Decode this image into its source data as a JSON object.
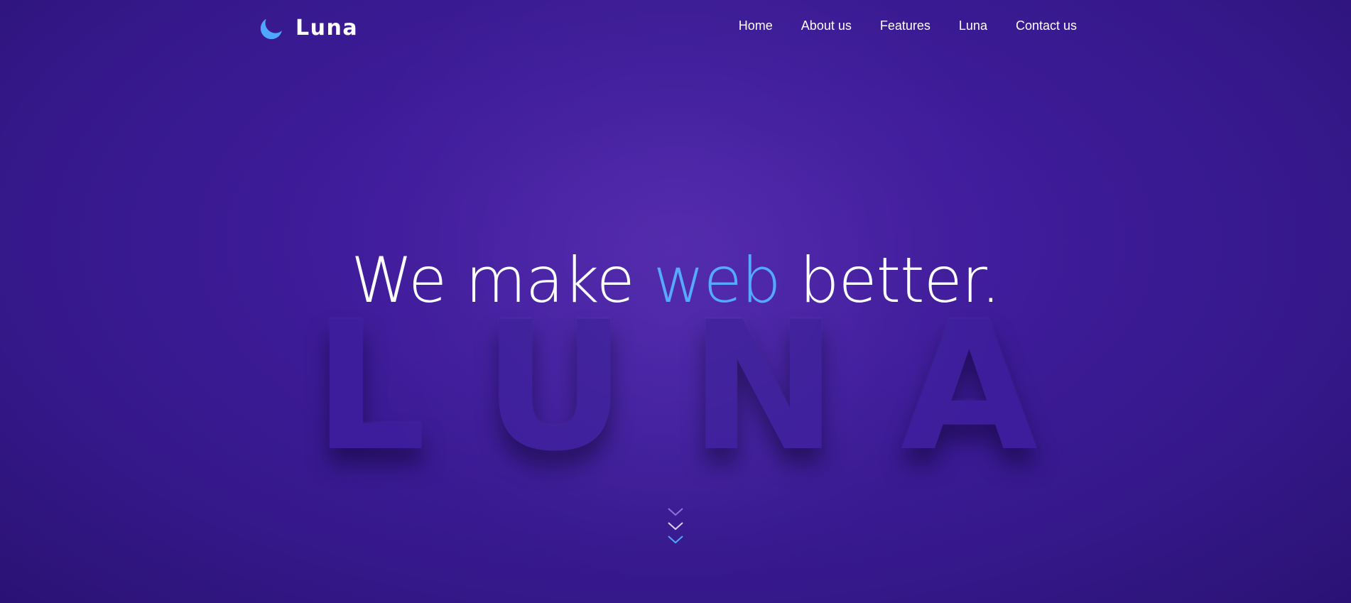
{
  "colors": {
    "background": "#3f1c9b",
    "accent": "#4fa6ff",
    "text": "#ffffff",
    "background_word": "#3d1d9b"
  },
  "brand": {
    "icon": "moon-icon",
    "name": "Luna"
  },
  "nav": {
    "items": [
      {
        "label": "Home"
      },
      {
        "label": "About us"
      },
      {
        "label": "Features"
      },
      {
        "label": "Luna"
      },
      {
        "label": "Contact us"
      }
    ]
  },
  "hero": {
    "headline_before": "We make ",
    "headline_accent": "web",
    "headline_after": " better.",
    "background_word": "LUNA",
    "scroll_icon": "chevrons-down-icon"
  }
}
